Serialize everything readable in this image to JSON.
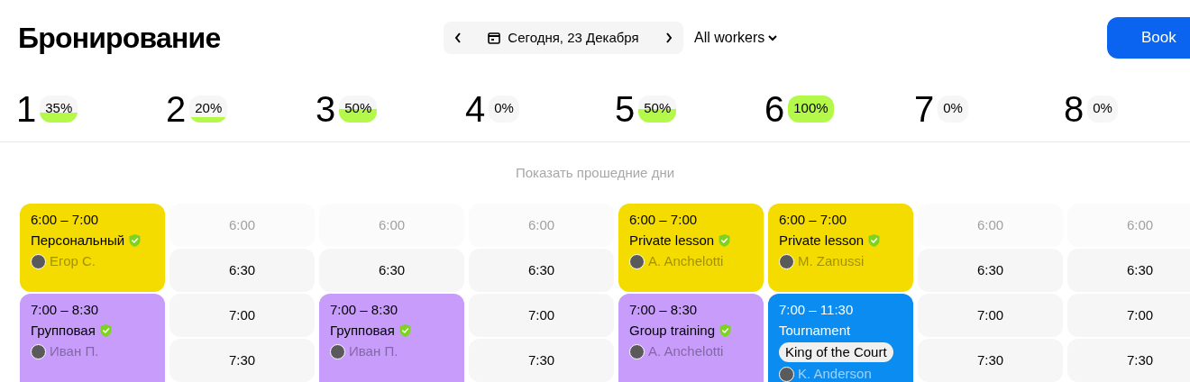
{
  "title": "Бронирование",
  "date_nav": {
    "label": "Сегодня, 23 Декабря"
  },
  "workers_filter": {
    "label": "All workers"
  },
  "book_button": {
    "label": "Book"
  },
  "days": [
    {
      "number": "1",
      "percent": "35%"
    },
    {
      "number": "2",
      "percent": "20%"
    },
    {
      "number": "3",
      "percent": "50%"
    },
    {
      "number": "4",
      "percent": "0%"
    },
    {
      "number": "5",
      "percent": "50%"
    },
    {
      "number": "6",
      "percent": "100%"
    },
    {
      "number": "7",
      "percent": "0%"
    },
    {
      "number": "8",
      "percent": "0%"
    }
  ],
  "show_past_link": "Показать прошедние дни",
  "columns": [
    {
      "items": [
        {
          "kind": "booking",
          "time": "6:00 – 7:00",
          "title": "Персональный",
          "verified": true,
          "person": "Егор С.",
          "color": "#f5dc00"
        },
        {
          "kind": "booking",
          "time": "7:00 – 8:30",
          "title": "Групповая",
          "verified": true,
          "person": "Иван П.",
          "color": "#c89cfb"
        }
      ]
    },
    {
      "items": [
        {
          "kind": "slot",
          "time": "6:00",
          "past": true
        },
        {
          "kind": "slot",
          "time": "6:30",
          "past": false
        },
        {
          "kind": "slot",
          "time": "7:00",
          "past": false
        },
        {
          "kind": "slot",
          "time": "7:30",
          "past": false
        }
      ]
    },
    {
      "items": [
        {
          "kind": "slot",
          "time": "6:00",
          "past": true
        },
        {
          "kind": "slot",
          "time": "6:30",
          "past": false
        },
        {
          "kind": "booking",
          "time": "7:00 – 8:30",
          "title": "Групповая",
          "verified": true,
          "person": "Иван П.",
          "color": "#c89cfb"
        }
      ]
    },
    {
      "items": [
        {
          "kind": "slot",
          "time": "6:00",
          "past": true
        },
        {
          "kind": "slot",
          "time": "6:30",
          "past": false
        },
        {
          "kind": "slot",
          "time": "7:00",
          "past": false
        },
        {
          "kind": "slot",
          "time": "7:30",
          "past": false
        }
      ]
    },
    {
      "items": [
        {
          "kind": "booking",
          "time": "6:00 – 7:00",
          "title": "Private lesson",
          "verified": true,
          "person": "A. Anchelotti",
          "color": "#f5dc00"
        },
        {
          "kind": "booking",
          "time": "7:00 – 8:30",
          "title": "Group training",
          "verified": true,
          "person": "A. Anchelotti",
          "color": "#c89cfb"
        }
      ]
    },
    {
      "items": [
        {
          "kind": "booking",
          "time": "6:00 – 7:00",
          "title": "Private lesson",
          "verified": true,
          "person": "M. Zanussi",
          "color": "#f5dc00"
        },
        {
          "kind": "booking",
          "time": "7:00 – 11:30",
          "title": "Tournament",
          "tag": "King of the Court",
          "verified": false,
          "person": "K. Anderson",
          "color": "#0a8cf0"
        }
      ]
    },
    {
      "items": [
        {
          "kind": "slot",
          "time": "6:00",
          "past": true
        },
        {
          "kind": "slot",
          "time": "6:30",
          "past": false
        },
        {
          "kind": "slot",
          "time": "7:00",
          "past": false
        },
        {
          "kind": "slot",
          "time": "7:30",
          "past": false
        }
      ]
    },
    {
      "items": [
        {
          "kind": "slot",
          "time": "6:00",
          "past": true
        },
        {
          "kind": "slot",
          "time": "6:30",
          "past": false
        },
        {
          "kind": "slot",
          "time": "7:00",
          "past": false
        },
        {
          "kind": "slot",
          "time": "7:30",
          "past": false
        }
      ]
    }
  ]
}
